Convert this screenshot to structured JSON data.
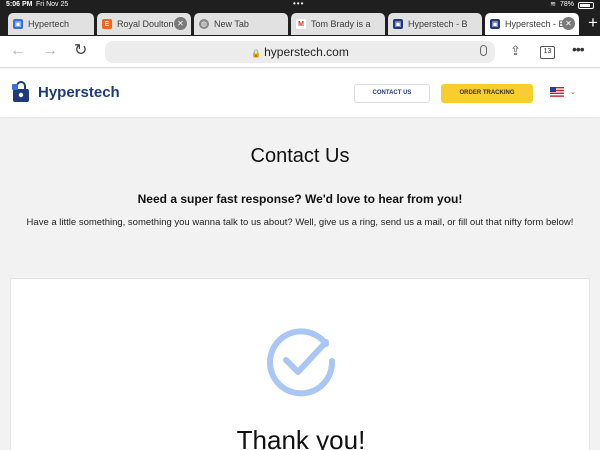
{
  "status_bar": {
    "time": "5:06 PM",
    "date": "Fri Nov 25",
    "battery": "78%"
  },
  "tabs": [
    {
      "title": "Hypertech",
      "favicon": "hypertech-favicon",
      "active": false
    },
    {
      "title": "Royal Doulton",
      "favicon": "etsy-favicon",
      "active": false
    },
    {
      "title": "New Tab",
      "favicon": "globe-icon",
      "active": false
    },
    {
      "title": "Tom Brady is a",
      "favicon": "gmail-favicon",
      "active": false
    },
    {
      "title": "Hyperstech - B",
      "favicon": "hyperstech-favicon",
      "active": false
    },
    {
      "title": "Hyperstech - B",
      "favicon": "hyperstech-favicon",
      "active": true
    }
  ],
  "toolbar": {
    "url": "hyperstech.com",
    "tab_count": "13"
  },
  "site": {
    "brand": "Hyperstech",
    "contact_label": "CONTACT US",
    "order_label": "ORDER TRACKING",
    "accent_color": "#f8cd2e",
    "brand_color": "#1f3a7a"
  },
  "content": {
    "title": "Contact Us",
    "subtitle": "Need a super fast response? We'd love to hear from you!",
    "description": "Have a little something, something you wanna talk to us about? Well, give us a ring, send us a mail, or fill out that nifty form below!",
    "thanks": "Thank you!"
  }
}
